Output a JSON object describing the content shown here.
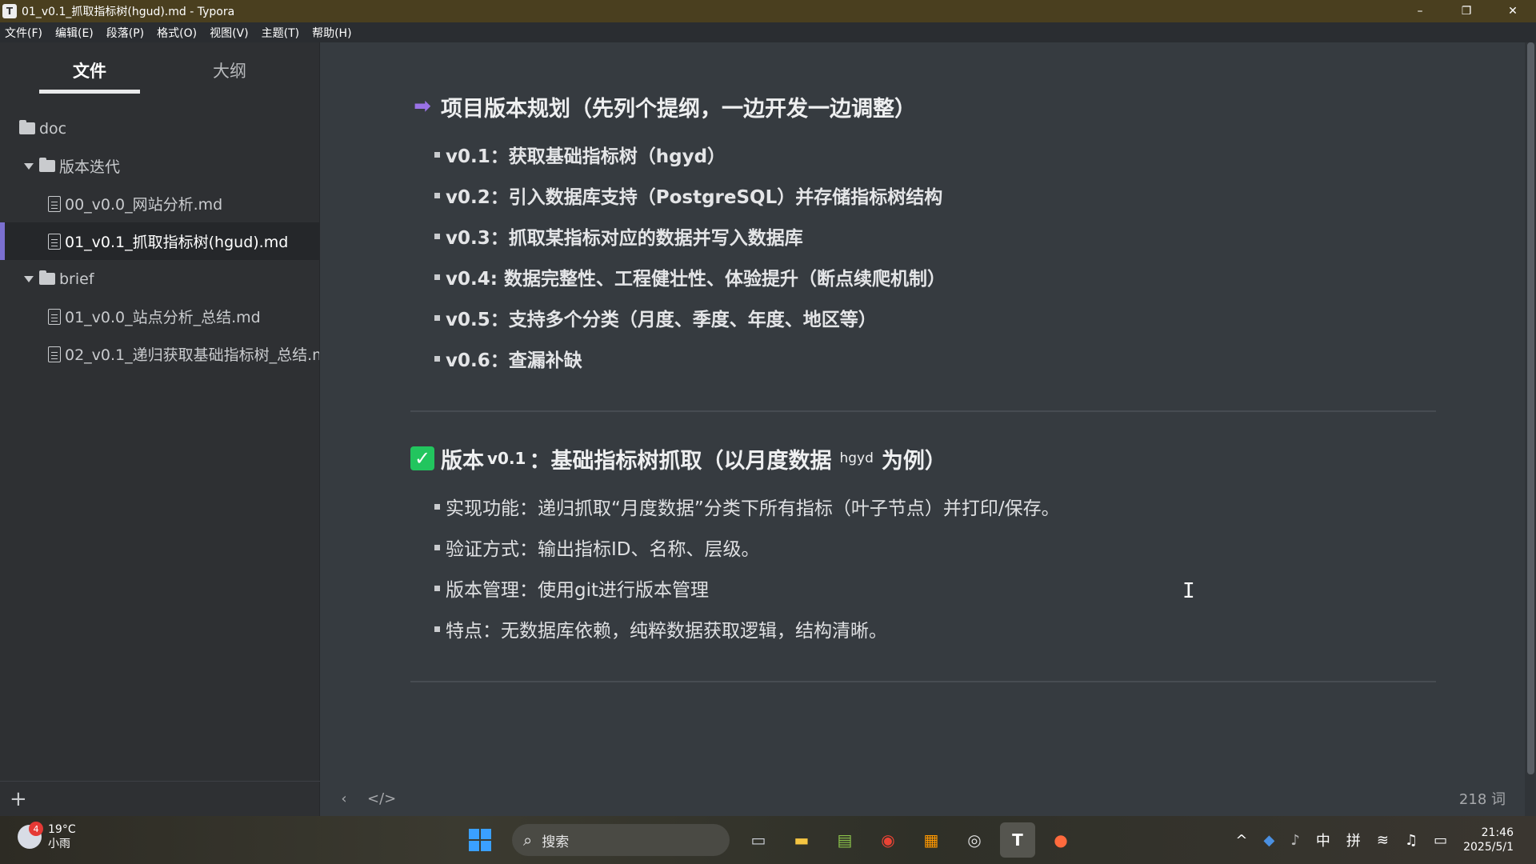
{
  "window": {
    "title": "01_v0.1_抓取指标树(hgud).md - Typora",
    "app_icon_letter": "T",
    "minimize": "–",
    "maximize": "❐",
    "close": "✕"
  },
  "menu": [
    "文件(F)",
    "编辑(E)",
    "段落(P)",
    "格式(O)",
    "视图(V)",
    "主题(T)",
    "帮助(H)"
  ],
  "sidebar": {
    "tab_files": "文件",
    "tab_outline": "大纲",
    "tree": {
      "root": "doc",
      "folder1": "版本迭代",
      "file1": "00_v0.0_网站分析.md",
      "file2": "01_v0.1_抓取指标树(hgud).md",
      "folder2": "brief",
      "file3": "01_v0.0_站点分析_总结.md",
      "file4": "02_v0.1_递归获取基础指标树_总结.md"
    },
    "add_label": "+"
  },
  "doc": {
    "h1": {
      "emoji_text": "➡",
      "title": "项目版本规划（先列个提纲，一边开发一边调整）"
    },
    "list1": [
      "v0.1：获取基础指标树（hgyd）",
      "v0.2：引入数据库支持（PostgreSQL）并存储指标树结构",
      "v0.3：抓取某指标对应的数据并写入数据库",
      "v0.4: 数据完整性、工程健壮性、体验提升（断点续爬机制）",
      "v0.5：支持多个分类（月度、季度、年度、地区等）",
      "v0.6：查漏补缺"
    ],
    "h2": {
      "check": "✓",
      "part1": "版本",
      "version": "v0.1",
      "part2": "：基础指标树抓取（以月度数据",
      "code": "hgyd",
      "part3": "为例）"
    },
    "list2": [
      "实现功能：递归抓取“月度数据”分类下所有指标（叶子节点）并打印/保存。",
      "验证方式：输出指标ID、名称、层级。",
      "版本管理：使用git进行版本管理",
      "特点：无数据库依赖，纯粹数据获取逻辑，结构清晰。"
    ]
  },
  "footer": {
    "back": "‹",
    "source": "</>",
    "word_count": "218 词"
  },
  "taskbar": {
    "weather_badge": "4",
    "temperature": "19°C",
    "weather_desc": "小雨",
    "search_placeholder": "搜索",
    "tray_chevron": "^",
    "ime_lang": "中",
    "ime_mode": "拼",
    "time": "21:46",
    "date": "2025/5/1"
  },
  "colors": {
    "accent": "#7b6fd0",
    "check_green": "#22c55e",
    "soon_purple": "#9a72e6"
  }
}
